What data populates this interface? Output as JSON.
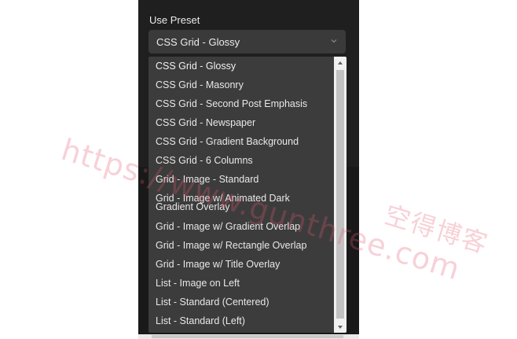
{
  "panel": {
    "section_label": "Use Preset",
    "select": {
      "value": "CSS Grid - Glossy",
      "icon": "chevron-down-icon"
    },
    "options": [
      "CSS Grid - Glossy",
      "CSS Grid - Masonry",
      "CSS Grid - Second Post Emphasis",
      "CSS Grid - Newspaper",
      "CSS Grid - Gradient Background",
      "CSS Grid - 6 Columns",
      "Grid - Image - Standard",
      "Grid - Image w/ Animated Dark Gradient Overlay",
      "Grid - Image w/ Gradient Overlap",
      "Grid - Image w/ Rectangle Overlap",
      "Grid - Image w/ Title Overlay",
      "List - Image on Left",
      "List - Standard (Centered)",
      "List - Standard (Left)"
    ]
  },
  "watermark": {
    "url": "https://www.gunthree.com",
    "name": "空得博客"
  },
  "colors": {
    "panel_bg": "#1f1f1f",
    "dropdown_bg": "#3c3c3c",
    "select_bg": "#3a3a3a",
    "text": "#e8e8e8",
    "watermark": "#e15a6e"
  }
}
